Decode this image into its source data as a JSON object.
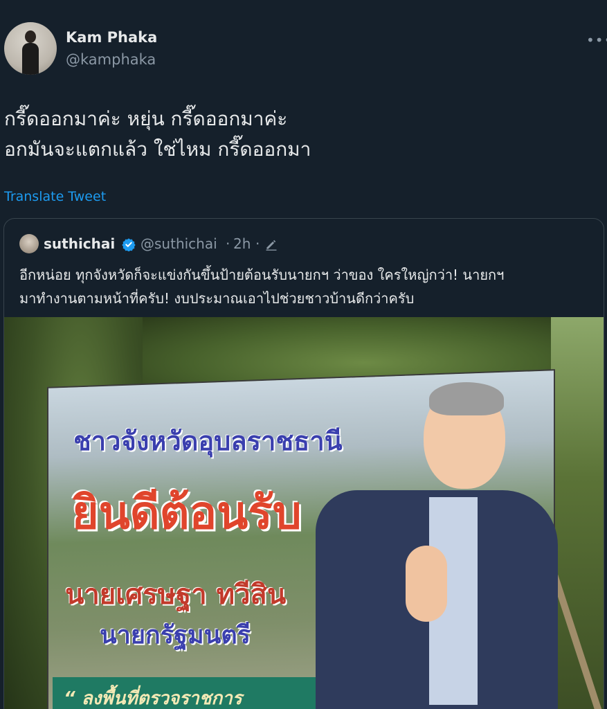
{
  "author": {
    "display_name": "Kam Phaka",
    "handle": "@kamphaka"
  },
  "menu_icon": "more-horizontal-icon",
  "tweet": {
    "lines": [
      "กรี๊ดออกมาค่ะ หยุ่น กรี๊ดออกมาค่ะ",
      "อกมันจะแตกแล้ว ใช่ไหม กรี๊ดออกมา"
    ],
    "translate_label": "Translate Tweet"
  },
  "quoted": {
    "display_name": "suthichai",
    "handle": "@suthichai",
    "separator": "·",
    "time": "2h",
    "lines": [
      "อีกหน่อย ทุกจังหวัดก็จะแข่งกันขึ้นป้ายต้อนรับนายกฯ ว่าของ ใครใหญ่กว่า! นายกฯ",
      "มาทำงานตามหน้าที่ครับ! งบประมาณเอาไปช่วยชาวบ้านดีกว่าครับ"
    ],
    "verified_color": "#1d9bf0",
    "photo": {
      "billboard": {
        "line1": "ชาวจังหวัดอุบลราชธานี",
        "line2": "ยินดีต้อนรับ",
        "line3": "นายเศรษฐา ทวีสิน",
        "line4": "นายกรัฐมนตรี",
        "line5": "“ ลงพื้นที่ตรวจราชการ"
      }
    }
  },
  "colors": {
    "background": "#15202b",
    "link": "#1d9bf0",
    "secondary_text": "#8b98a5"
  }
}
